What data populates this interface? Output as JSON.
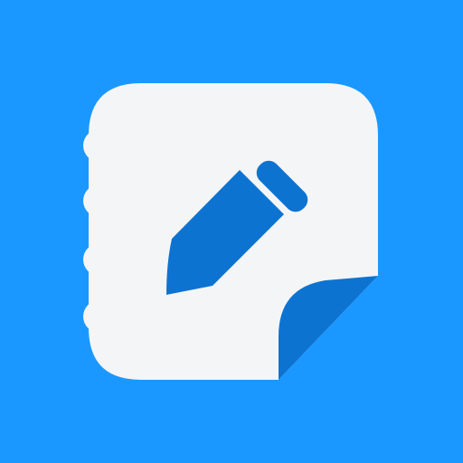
{
  "icon": {
    "name": "notepad-pencil-icon",
    "colors": {
      "background": "#1a98ff",
      "paper": "#f4f5f6",
      "accent": "#0d73d1"
    }
  }
}
